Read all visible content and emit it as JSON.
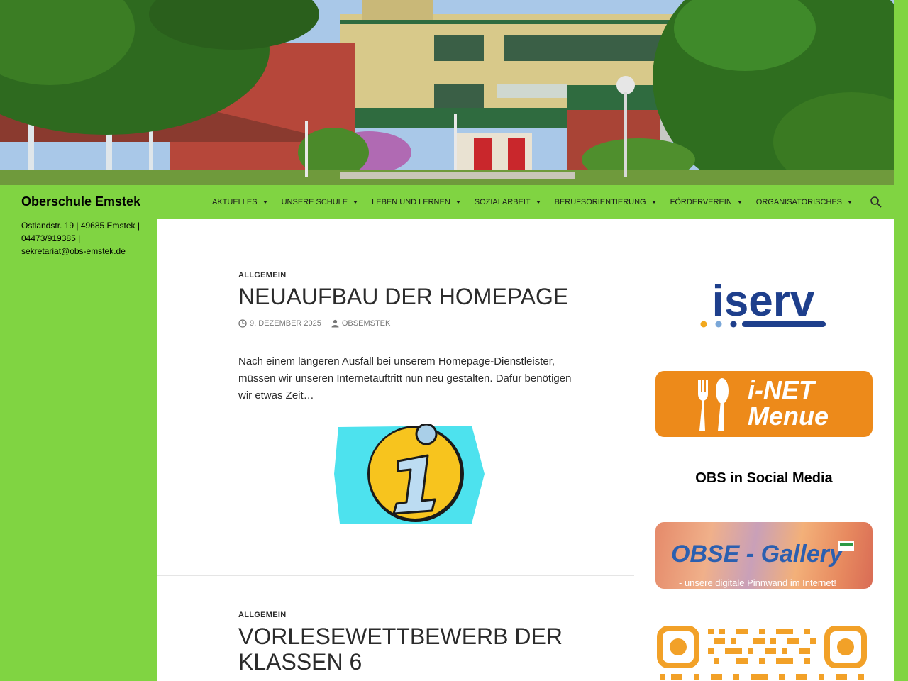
{
  "site": {
    "title": "Oberschule Emstek",
    "description": "Ostlandstr. 19 | 49685 Emstek | 04473/919385 | sekretariat@obs-emstek.de"
  },
  "nav": [
    {
      "label": "AKTUELLES"
    },
    {
      "label": "UNSERE SCHULE"
    },
    {
      "label": "LEBEN UND LERNEN"
    },
    {
      "label": "SOZIALARBEIT"
    },
    {
      "label": "BERUFSORIENTIERUNG"
    },
    {
      "label": "FÖRDERVEREIN"
    },
    {
      "label": "ORGANISATORISCHES"
    }
  ],
  "posts": [
    {
      "category": "ALLGEMEIN",
      "title": "NEUAUFBAU DER HOMEPAGE",
      "date": "9. DEZEMBER 2025",
      "author": "OBSEMSTEK",
      "excerpt": "Nach einem längeren Ausfall bei unserem Homepage-Dienstleister, müssen wir unseren Internetauftritt nun neu gestalten. Dafür benötigen wir etwas Zeit…"
    },
    {
      "category": "ALLGEMEIN",
      "title": "VORLESEWETTBEWERB DER KLASSEN 6"
    }
  ],
  "sidebar": {
    "iserv_logo": "iserv",
    "menue_line1": "i-NET",
    "menue_line2": "Menue",
    "social_heading": "OBS in Social Media",
    "gallery_title": "OBSE - Gallery",
    "gallery_sub": "- unsere digitale Pinnwand im Internet!"
  },
  "colors": {
    "accent": "#80d442",
    "iserv_blue": "#1e3f8c",
    "menue_orange": "#ed8a1a",
    "qr_orange": "#f2a128"
  },
  "icons": {
    "search": "search-icon",
    "clock": "clock-icon",
    "user": "user-icon",
    "info": "info-icon"
  }
}
